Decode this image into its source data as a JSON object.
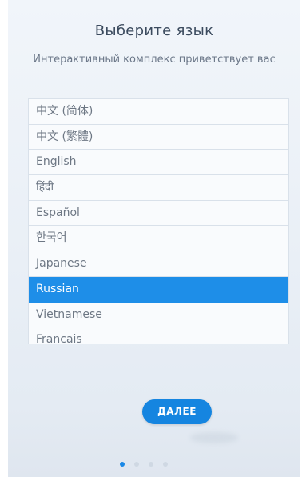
{
  "header": {
    "title": "Выберите язык",
    "subtitle": "Интерактивный комплекс приветствует вас"
  },
  "languages": [
    {
      "label": "中文 (简体)",
      "selected": false
    },
    {
      "label": "中文 (繁體)",
      "selected": false
    },
    {
      "label": "English",
      "selected": false
    },
    {
      "label": "हिंदी",
      "selected": false
    },
    {
      "label": "Español",
      "selected": false
    },
    {
      "label": "한국어",
      "selected": false
    },
    {
      "label": "Japanese",
      "selected": false
    },
    {
      "label": "Russian",
      "selected": true
    },
    {
      "label": "Vietnamese",
      "selected": false
    },
    {
      "label": "Francais",
      "selected": false
    }
  ],
  "footer": {
    "next_label": "ДАЛЕЕ",
    "page_count": 4,
    "current_page": 1
  },
  "colors": {
    "accent": "#1e8ee8",
    "button": "#1585e0",
    "background": "#eef3f8"
  }
}
